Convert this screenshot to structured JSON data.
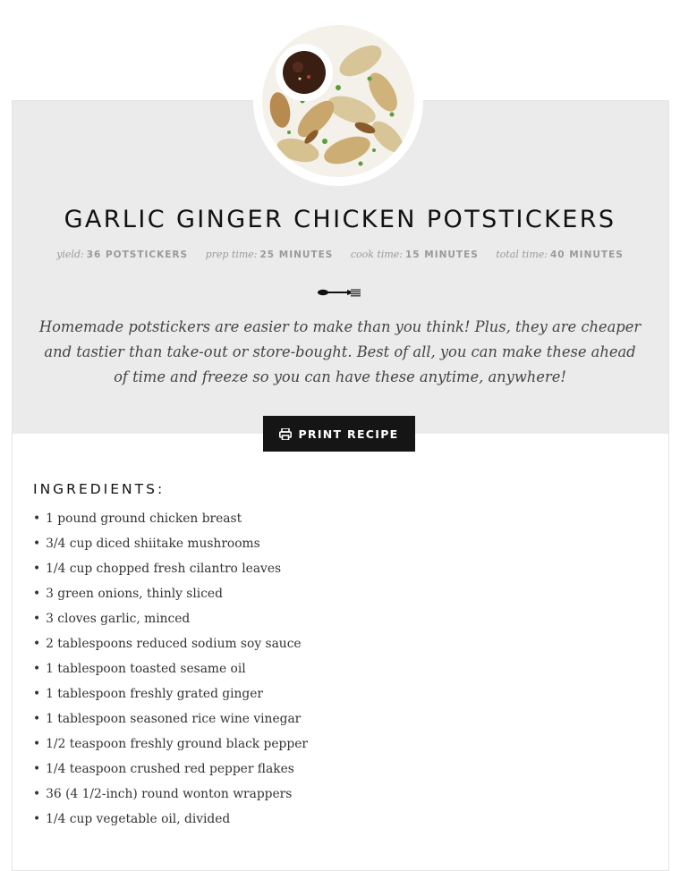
{
  "recipe": {
    "title": "GARLIC GINGER CHICKEN POTSTICKERS",
    "meta": {
      "yield_label": "yield:",
      "yield_value": "36 POTSTICKERS",
      "prep_label": "prep time:",
      "prep_value": "25 MINUTES",
      "cook_label": "cook time:",
      "cook_value": "15 MINUTES",
      "total_label": "total time:",
      "total_value": "40 MINUTES"
    },
    "summary": "Homemade potstickers are easier to make than you think! Plus, they are cheaper and tastier than take-out or store-bought. Best of all, you can make these ahead of time and freeze so you can have these anytime, anywhere!",
    "print_label": "PRINT RECIPE",
    "ingredients_heading": "INGREDIENTS:",
    "bullet": "•",
    "ingredients": [
      "1 pound ground chicken breast",
      "3/4 cup diced shiitake mushrooms",
      "1/4 cup chopped fresh cilantro leaves",
      "3 green onions, thinly sliced",
      "3 cloves garlic, minced",
      "2 tablespoons reduced sodium soy sauce",
      "1 tablespoon toasted sesame oil",
      "1 tablespoon freshly grated ginger",
      "1 tablespoon seasoned rice wine vinegar",
      "1/2 teaspoon freshly ground black pepper",
      "1/4 teaspoon crushed red pepper flakes",
      "36 (4 1/2-inch) round wonton wrappers",
      "1/4 cup vegetable oil, divided"
    ]
  },
  "icons": {
    "photo": "potstickers-photo",
    "divider": "fork-divider-icon",
    "print": "printer-icon"
  },
  "colors": {
    "header_band": "#ebebeb",
    "button_bg": "#151515",
    "title_text": "#111111",
    "meta_text": "#9a9a9a"
  }
}
